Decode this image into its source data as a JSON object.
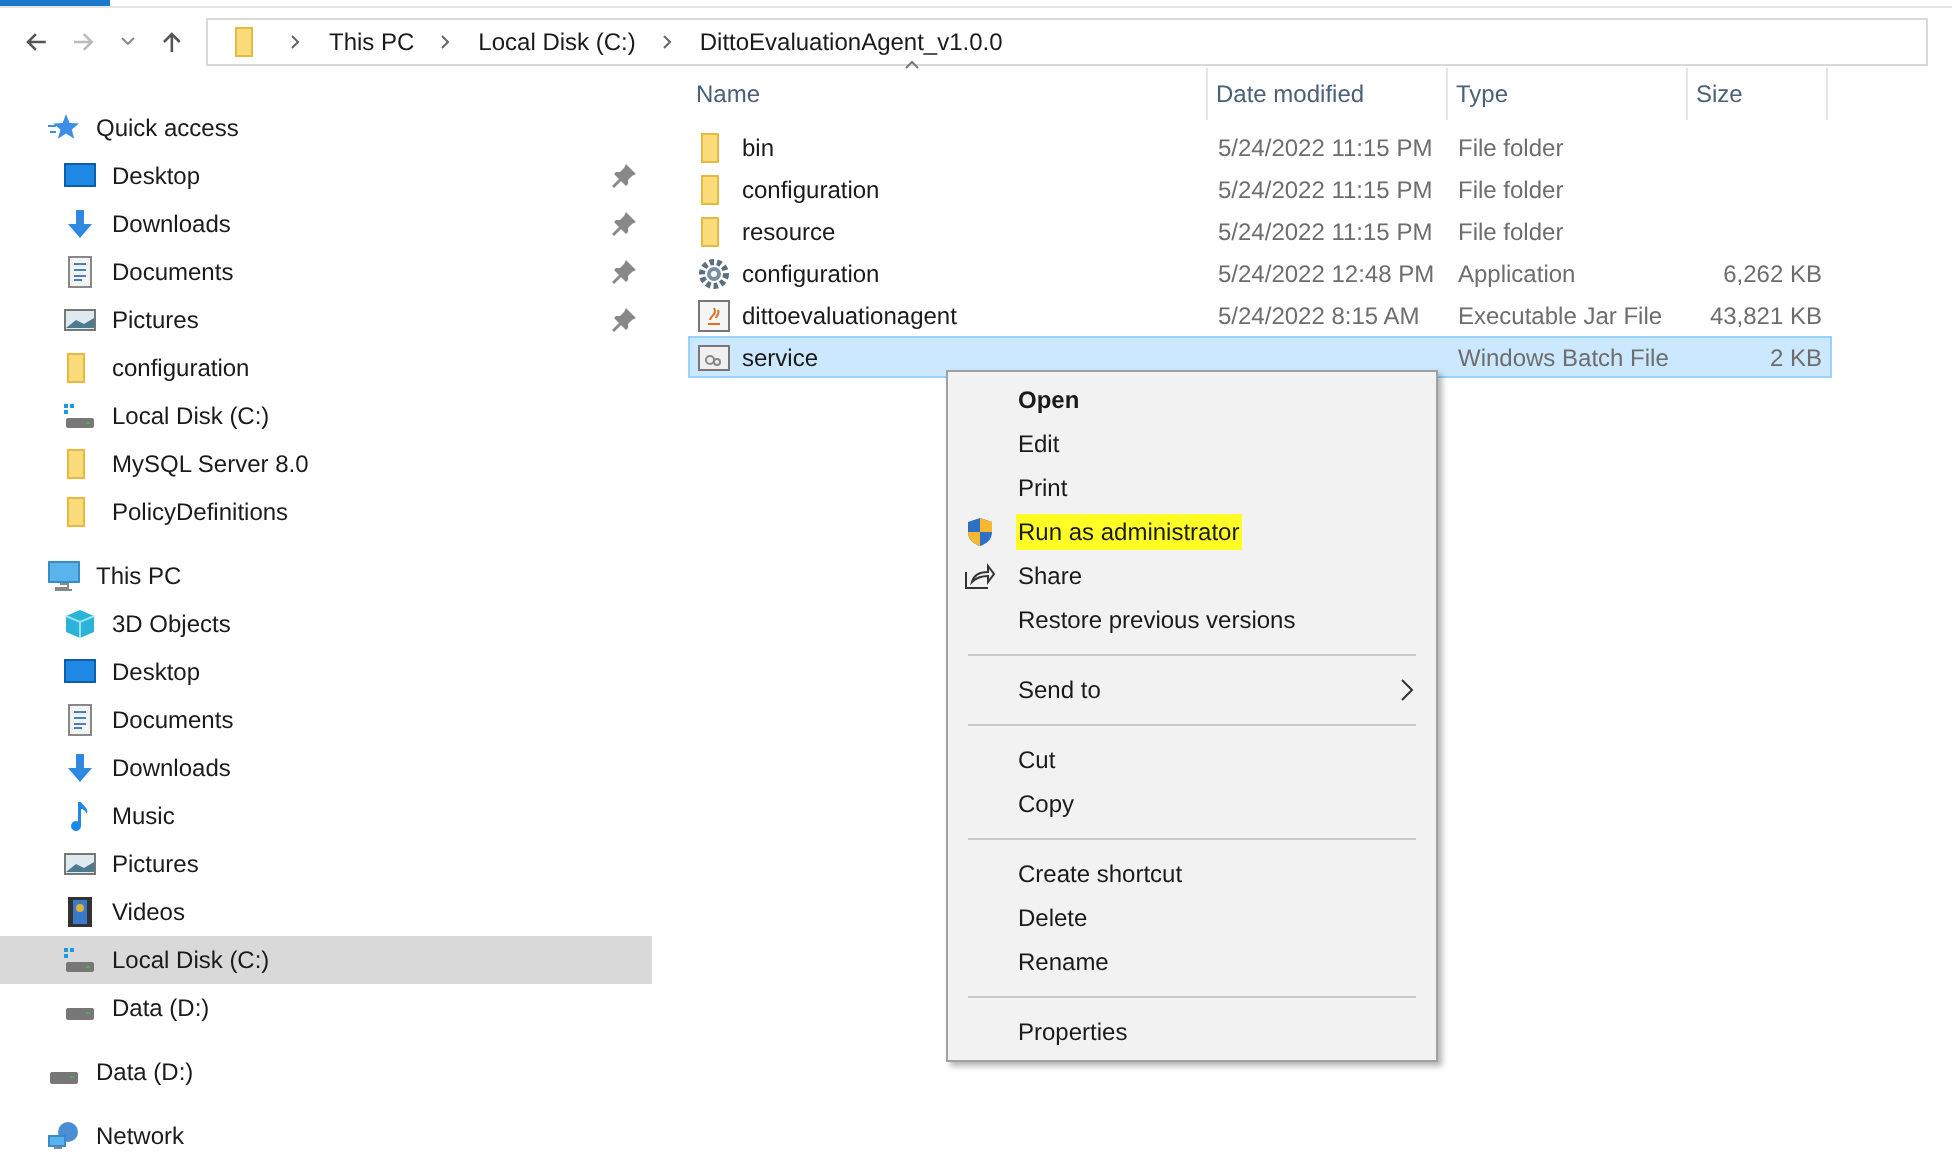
{
  "breadcrumb": [
    "This PC",
    "Local Disk (C:)",
    "DittoEvaluationAgent_v1.0.0"
  ],
  "sidebar": {
    "items": [
      {
        "label": "Quick access",
        "kind": "star",
        "selected": false,
        "children": [
          {
            "label": "Desktop",
            "kind": "desktop",
            "pinned": true,
            "selected": false
          },
          {
            "label": "Downloads",
            "kind": "downloads",
            "pinned": true,
            "selected": false
          },
          {
            "label": "Documents",
            "kind": "documents",
            "pinned": true,
            "selected": false
          },
          {
            "label": "Pictures",
            "kind": "pictures",
            "pinned": true,
            "selected": false
          },
          {
            "label": "configuration",
            "kind": "folder",
            "pinned": false,
            "selected": false
          },
          {
            "label": "Local Disk (C:)",
            "kind": "system-drive",
            "pinned": false,
            "selected": false
          },
          {
            "label": "MySQL Server 8.0",
            "kind": "folder",
            "pinned": false,
            "selected": false
          },
          {
            "label": "PolicyDefinitions",
            "kind": "folder",
            "pinned": false,
            "selected": false
          }
        ]
      },
      {
        "label": "This PC",
        "kind": "pc",
        "selected": false,
        "children": [
          {
            "label": "3D Objects",
            "kind": "objects",
            "selected": false
          },
          {
            "label": "Desktop",
            "kind": "desktop",
            "selected": false
          },
          {
            "label": "Documents",
            "kind": "documents",
            "selected": false
          },
          {
            "label": "Downloads",
            "kind": "downloads",
            "selected": false
          },
          {
            "label": "Music",
            "kind": "music",
            "selected": false
          },
          {
            "label": "Pictures",
            "kind": "pictures",
            "selected": false
          },
          {
            "label": "Videos",
            "kind": "videos",
            "selected": false
          },
          {
            "label": "Local Disk (C:)",
            "kind": "system-drive",
            "selected": true
          },
          {
            "label": "Data (D:)",
            "kind": "drive",
            "selected": false
          }
        ]
      },
      {
        "label": "Data (D:)",
        "kind": "drive",
        "selected": false
      },
      {
        "label": "Network",
        "kind": "network",
        "selected": false
      }
    ]
  },
  "table": {
    "columns": [
      "Name",
      "Date modified",
      "Type",
      "Size"
    ],
    "rows": [
      {
        "kind": "folder",
        "name": "bin",
        "date": "5/24/2022 11:15 PM",
        "type": "File folder",
        "selected": false
      },
      {
        "kind": "folder",
        "name": "configuration",
        "date": "5/24/2022 11:15 PM",
        "type": "File folder",
        "selected": false
      },
      {
        "kind": "folder",
        "name": "resource",
        "date": "5/24/2022 11:15 PM",
        "type": "File folder",
        "selected": false
      },
      {
        "kind": "app",
        "name": "configuration",
        "date": "5/24/2022 12:48 PM",
        "type": "Application",
        "size": "6,262 KB",
        "selected": false
      },
      {
        "kind": "jar",
        "name": "dittoevaluationagent",
        "date": "5/24/2022 8:15 AM",
        "type": "Executable Jar File",
        "size": "43,821 KB",
        "selected": false
      },
      {
        "kind": "batch",
        "name": "service",
        "type": "Windows Batch File",
        "size": "2 KB",
        "selected": true
      }
    ]
  },
  "context_menu": {
    "items": [
      {
        "kind": "item",
        "label": "Open",
        "default": true
      },
      {
        "kind": "item",
        "label": "Edit"
      },
      {
        "kind": "item",
        "label": "Print"
      },
      {
        "kind": "admin",
        "label": "Run as administrator",
        "highlighted": true
      },
      {
        "kind": "sharing",
        "label": "Share"
      },
      {
        "kind": "item",
        "label": "Restore previous versions"
      },
      {
        "kind": "separator"
      },
      {
        "kind": "item",
        "label": "Send to",
        "submenu": true
      },
      {
        "kind": "separator"
      },
      {
        "kind": "item",
        "label": "Cut"
      },
      {
        "kind": "item",
        "label": "Copy"
      },
      {
        "kind": "separator"
      },
      {
        "kind": "item",
        "label": "Create shortcut"
      },
      {
        "kind": "item",
        "label": "Delete"
      },
      {
        "kind": "item",
        "label": "Rename"
      },
      {
        "kind": "separator"
      },
      {
        "kind": "item",
        "label": "Properties"
      }
    ]
  }
}
